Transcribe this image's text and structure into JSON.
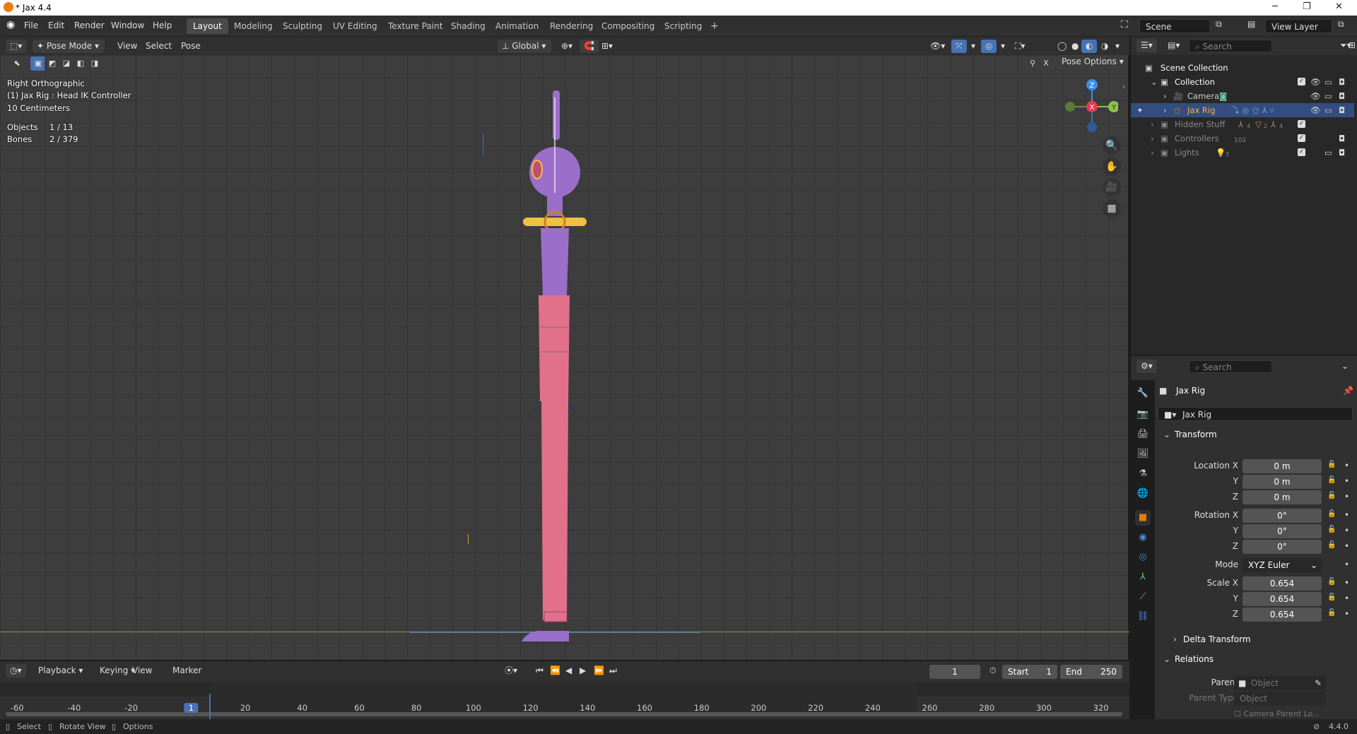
{
  "window": {
    "title": "* Jax 4.4",
    "minimize": "─",
    "restore": "❐",
    "close": "✕"
  },
  "menu": [
    "File",
    "Edit",
    "Render",
    "Window",
    "Help"
  ],
  "workspaces": [
    "Layout",
    "Modeling",
    "Sculpting",
    "UV Editing",
    "Texture Paint",
    "Shading",
    "Animation",
    "Rendering",
    "Compositing",
    "Scripting"
  ],
  "workspace_add": "+",
  "scene": {
    "label": "Scene",
    "view_layer": "View Layer"
  },
  "viewport_header": {
    "mode": "Pose Mode",
    "menus": [
      "View",
      "Select",
      "Pose"
    ],
    "orientation": "Global",
    "pose_options": "Pose Options",
    "x_toggle": "X"
  },
  "viewport_overlay": {
    "view_name": "Right Orthographic",
    "active": "(1) Jax Rig : Head IK Controller",
    "scale": "10 Centimeters",
    "objects_label": "Objects",
    "objects_value": "1 / 13",
    "bones_label": "Bones",
    "bones_value": "2 / 379"
  },
  "gizmo": {
    "z": "Z",
    "y": "Y",
    "x": "X"
  },
  "colors": {
    "accent": "#4772b3",
    "x_axis": "#e53a52",
    "y_axis": "#8bc34a",
    "z_axis": "#3d8de8",
    "body_pink": "#e2708a",
    "head_purple": "#9b6ec9",
    "bone_gold": "#f0c040",
    "selection": "#334d80"
  },
  "timeline": {
    "menus": [
      "Playback",
      "Keying",
      "View",
      "Marker"
    ],
    "current_frame": "1",
    "start_label": "Start",
    "start": "1",
    "end_label": "End",
    "end": "250",
    "ticks": [
      "-60",
      "-40",
      "-20",
      "1",
      "20",
      "40",
      "60",
      "80",
      "100",
      "120",
      "140",
      "160",
      "180",
      "200",
      "220",
      "240",
      "260",
      "280",
      "300",
      "320"
    ]
  },
  "statusbar": {
    "select": "Select",
    "rotate": "Rotate View",
    "options": "Options",
    "version": "4.4.0"
  },
  "outliner": {
    "search_placeholder": "Search",
    "root": "Scene Collection",
    "items": [
      {
        "name": "Collection",
        "icon": "collection-icon"
      },
      {
        "name": "Camera",
        "icon": "camera-icon"
      },
      {
        "name": "Jax Rig",
        "icon": "armature-icon"
      },
      {
        "name": "Hidden Stuff",
        "icon": "collection-icon",
        "badges": [
          "4",
          "2",
          "4"
        ]
      },
      {
        "name": "Controllers",
        "icon": "collection-icon",
        "badge": "102"
      },
      {
        "name": "Lights",
        "icon": "collection-icon",
        "badge": "3"
      }
    ]
  },
  "properties": {
    "search_placeholder": "Search",
    "object_header": "Jax Rig",
    "object_name": "Jax Rig",
    "transform_label": "Transform",
    "location_x_label": "Location X",
    "location_x": "0 m",
    "y_label": "Y",
    "location_y": "0 m",
    "z_label": "Z",
    "location_z": "0 m",
    "rotation_x_label": "Rotation X",
    "rotation_x": "0°",
    "rotation_y": "0°",
    "rotation_z": "0°",
    "mode_label": "Mode",
    "mode": "XYZ Euler",
    "scale_x_label": "Scale X",
    "scale_x": "0.654",
    "scale_y": "0.654",
    "scale_z": "0.654",
    "delta_transform_label": "Delta Transform",
    "relations_label": "Relations",
    "parent_label": "Parent",
    "parent_placeholder": "Object",
    "parent_type_label": "Parent Type",
    "parent_type": "Object",
    "camera_parent_lock": "Camera Parent Lo..."
  }
}
